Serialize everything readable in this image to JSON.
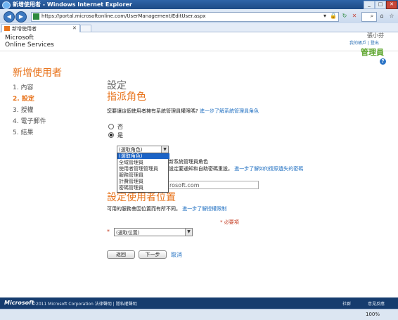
{
  "window": {
    "title": "新增使用者 - Windows Internet Explorer",
    "url": "https://portal.microsoftonline.com/UserManagement/EditUser.aspx",
    "tab_label": "新增使用者",
    "zoom": "100%"
  },
  "brand": {
    "line1": "Microsoft",
    "line2": "Online Services"
  },
  "user": {
    "name": "張小芬",
    "links": "我的帳戶 | 登出",
    "role": "管理員"
  },
  "wizard": {
    "title": "新增使用者",
    "steps": [
      {
        "label": "1.  內容"
      },
      {
        "label": "2.  設定"
      },
      {
        "label": "3.  授權"
      },
      {
        "label": "4.  電子郵件"
      },
      {
        "label": "5.  結果"
      }
    ]
  },
  "settings": {
    "section_title": "設定",
    "role_heading": "指派角色",
    "question": "您要讓這個使用者擁有系統管理員權限嗎?",
    "question_link": "進一步了解系統管理員角色",
    "radio_no": "否",
    "radio_yes": "是",
    "role_select_value": "(選取角色)",
    "role_options": [
      "(選取角色)",
      "全域管理員",
      "使用者管理管理員",
      "服務管理員",
      "計費管理員",
      "密碼管理員"
    ],
    "partial_text_1": "新系統管理員角色",
    "partial_text_2": "設定要通知和自助密碼重設。",
    "partial_link": "進一步了解如何復原遺失的密碼",
    "email_value": "rosoft.com"
  },
  "location": {
    "heading": "設定使用者位置",
    "question": "可用的服務會因位置而有所不同。",
    "question_link": "進一步了解授權限制",
    "required_note": "* 必要項",
    "required_star": "*",
    "select_value": "(選取位置)"
  },
  "buttons": {
    "back": "返回",
    "next": "下一步",
    "cancel": "取消"
  },
  "footer": {
    "logo": "Microsoft",
    "copyright": "©2011 Microsoft Corporation  法律聲明  |  隱私權聲明",
    "community": "社群",
    "feedback": "意見反應"
  }
}
